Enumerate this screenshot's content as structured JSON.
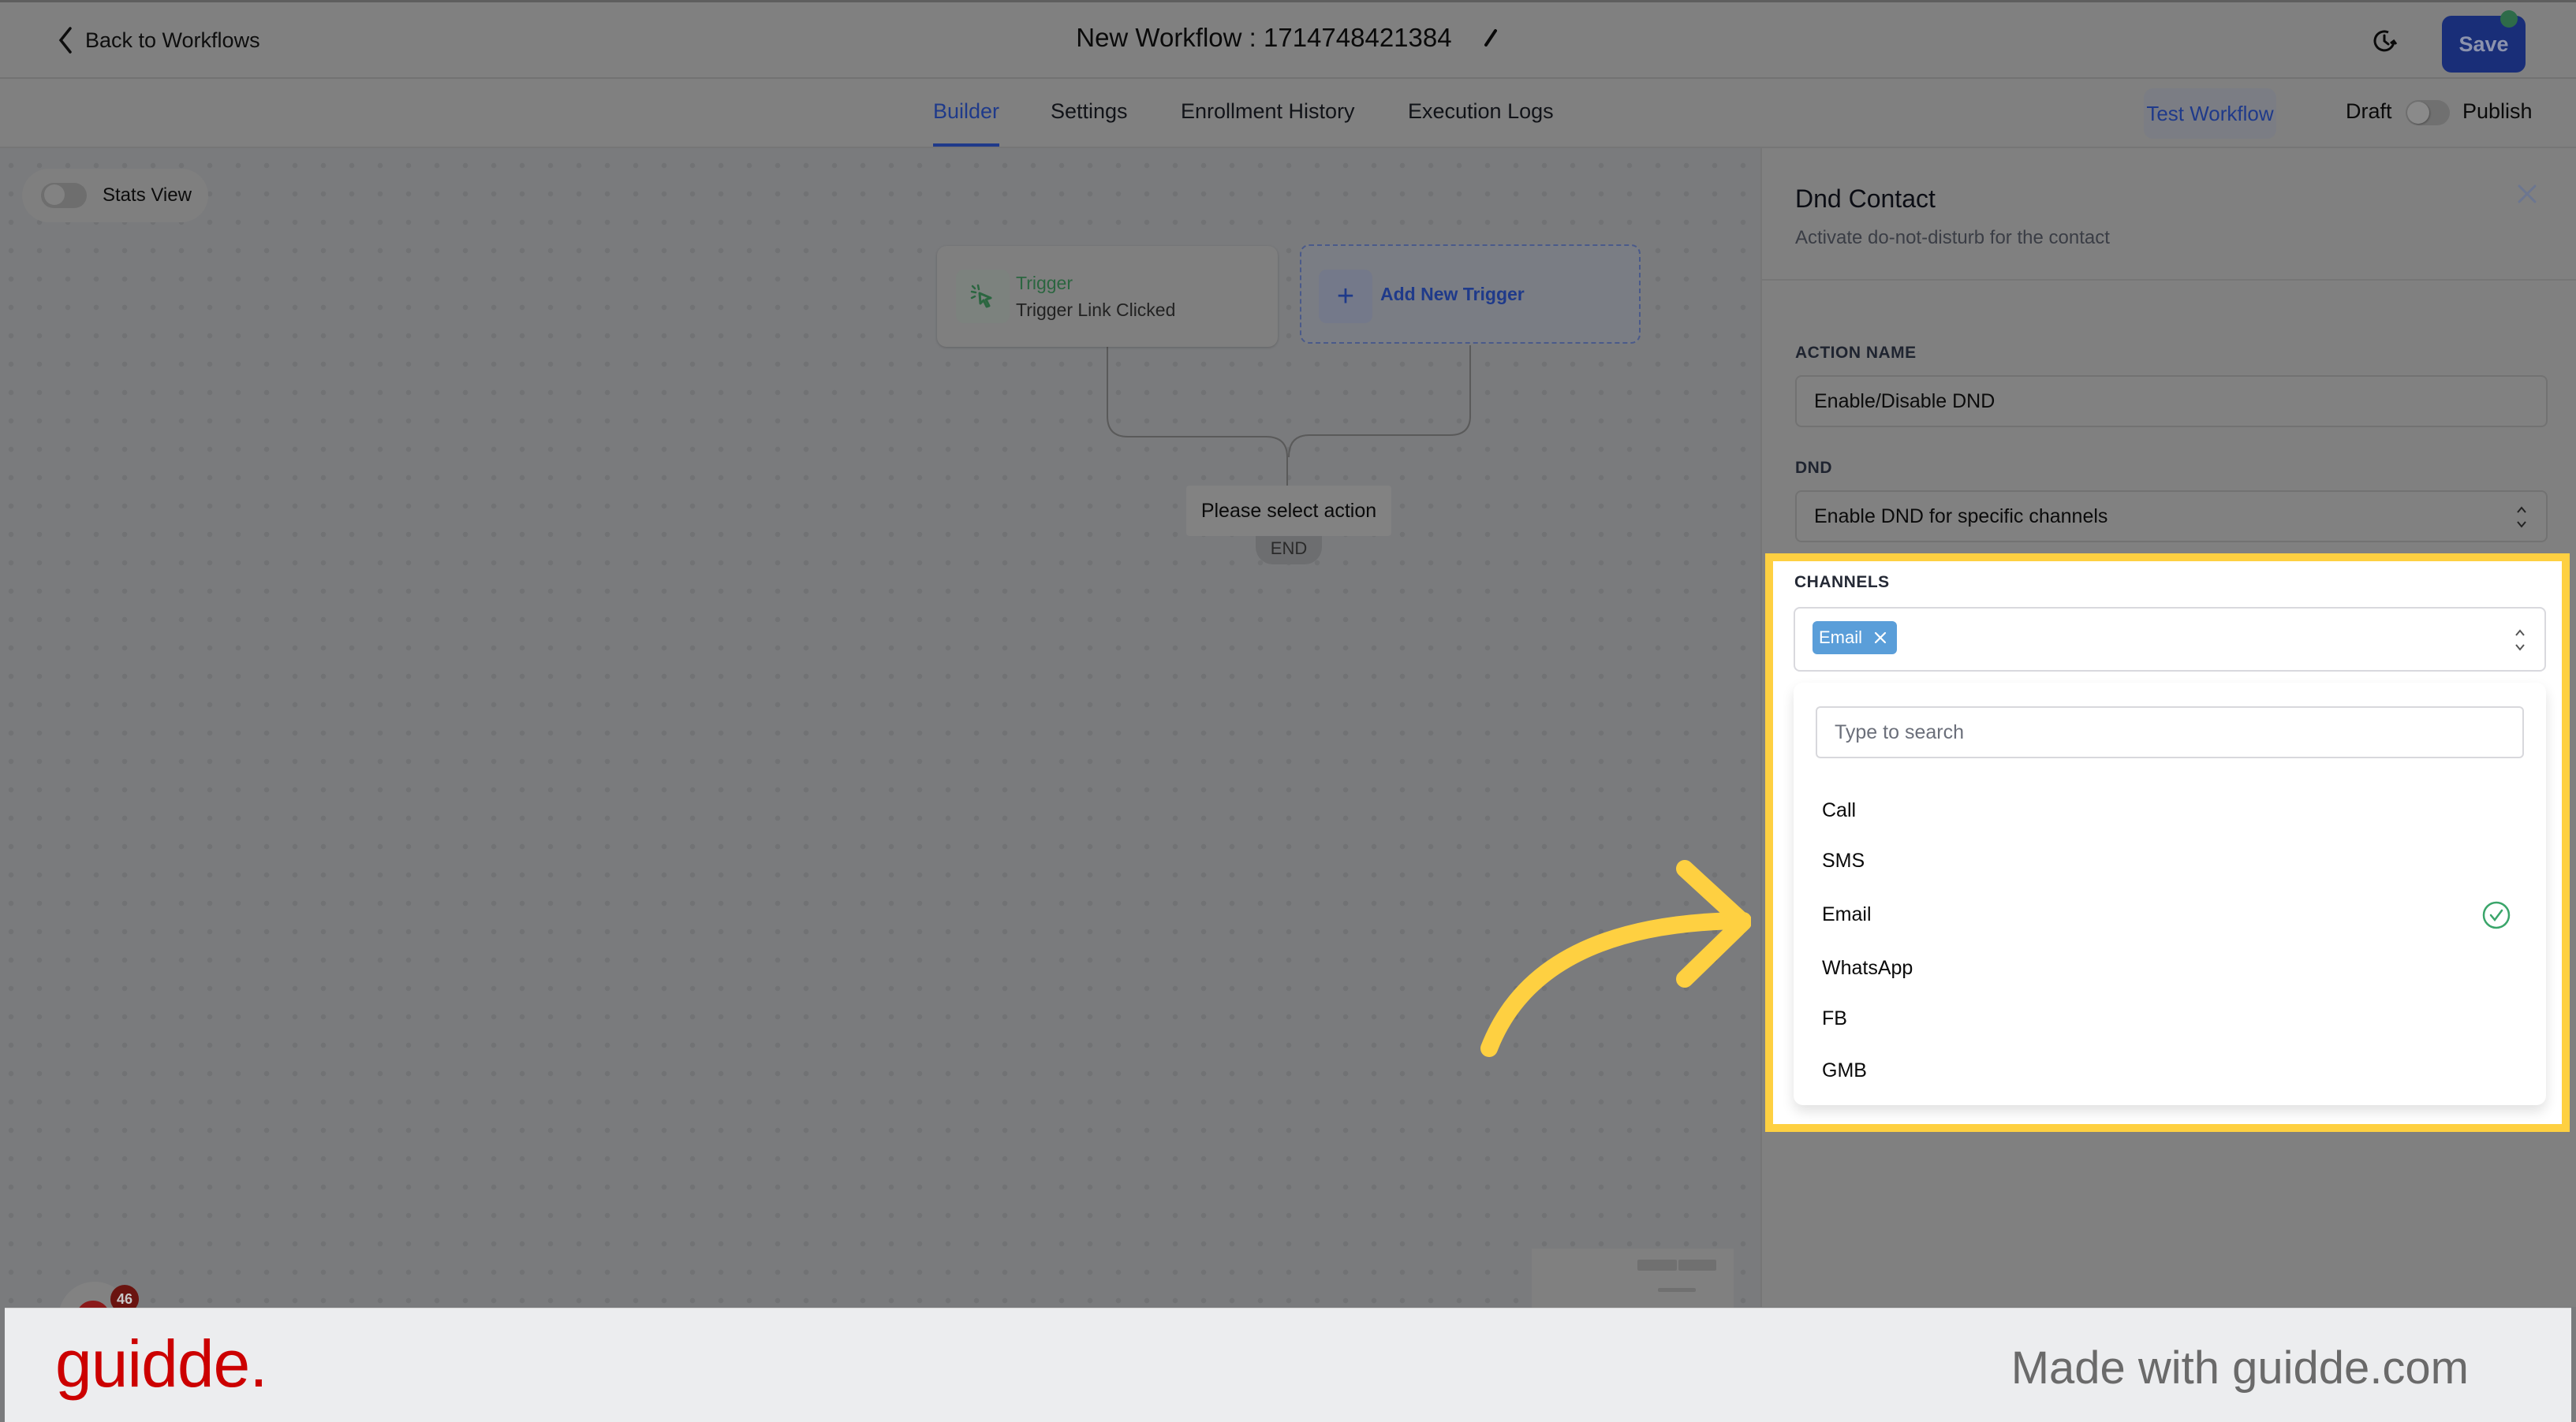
{
  "header": {
    "back_label": "Back to Workflows",
    "title": "New Workflow : 1714748421384",
    "save_label": "Save"
  },
  "tabs": [
    {
      "label": "Builder",
      "active": true
    },
    {
      "label": "Settings",
      "active": false
    },
    {
      "label": "Enrollment History",
      "active": false
    },
    {
      "label": "Execution Logs",
      "active": false
    }
  ],
  "toolbar": {
    "test_workflow_label": "Test Workflow",
    "draft_label": "Draft",
    "publish_label": "Publish",
    "publish_on": false
  },
  "canvas": {
    "stats_view_label": "Stats View",
    "stats_view_on": false,
    "trigger_node": {
      "type_label": "Trigger",
      "name": "Trigger Link Clicked"
    },
    "add_trigger_label": "Add New Trigger",
    "placeholder_action": "Please select action",
    "end_label": "END",
    "notification_count": "46"
  },
  "panel": {
    "title": "Dnd Contact",
    "subtitle": "Activate do-not-disturb for the contact",
    "action_name_label": "ACTION NAME",
    "action_name_value": "Enable/Disable DND",
    "dnd_label": "DND",
    "dnd_value": "Enable DND for specific channels",
    "channels_label": "CHANNELS",
    "selected_chips": [
      "Email"
    ],
    "search_placeholder": "Type to search",
    "options": [
      {
        "label": "Call",
        "selected": false
      },
      {
        "label": "SMS",
        "selected": false
      },
      {
        "label": "Email",
        "selected": true
      },
      {
        "label": "WhatsApp",
        "selected": false
      },
      {
        "label": "FB",
        "selected": false
      },
      {
        "label": "GMB",
        "selected": false
      }
    ]
  },
  "colors": {
    "accent_blue": "#1f3a8a",
    "chip_blue": "#5a9ed9",
    "highlight_yellow": "#fed041",
    "check_green": "#3aa56a",
    "brand_red": "#cc0000"
  },
  "footer": {
    "logo": "guidde.",
    "made_with": "Made with guidde.com"
  }
}
